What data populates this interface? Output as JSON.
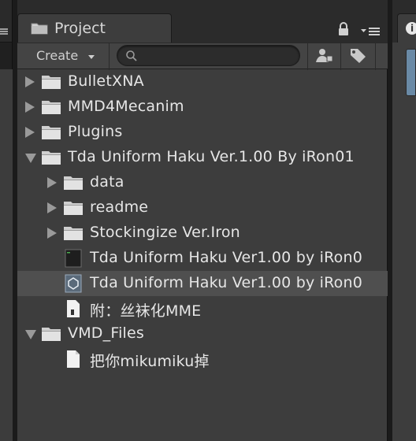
{
  "project_panel": {
    "tab_label": "Project",
    "create_label": "Create",
    "search_placeholder": "",
    "search_value": ""
  },
  "right_panel": {
    "tab_glyph": "i"
  },
  "tree": [
    {
      "label": "BulletXNA",
      "indent": 0,
      "arrow": "right",
      "icon": "folder-icon",
      "selected": false
    },
    {
      "label": "MMD4Mecanim",
      "indent": 0,
      "arrow": "right",
      "icon": "folder-icon",
      "selected": false
    },
    {
      "label": "Plugins",
      "indent": 0,
      "arrow": "right",
      "icon": "folder-icon",
      "selected": false
    },
    {
      "label": "Tda Uniform Haku Ver.1.00 By iRon01",
      "indent": 0,
      "arrow": "down",
      "icon": "folder-icon",
      "selected": false
    },
    {
      "label": "data",
      "indent": 1,
      "arrow": "right",
      "icon": "folder-icon",
      "selected": false
    },
    {
      "label": "readme",
      "indent": 1,
      "arrow": "right",
      "icon": "folder-icon",
      "selected": false
    },
    {
      "label": "Stockingize Ver.Iron",
      "indent": 1,
      "arrow": "right",
      "icon": "folder-icon",
      "selected": false
    },
    {
      "label": "Tda Uniform Haku Ver1.00 by iRon0",
      "indent": 1,
      "arrow": "none",
      "icon": "terminal-file-icon",
      "selected": false
    },
    {
      "label": "Tda Uniform Haku Ver1.00 by iRon0",
      "indent": 1,
      "arrow": "none",
      "icon": "unity-asset-icon",
      "selected": true
    },
    {
      "label": "附：丝袜化MME",
      "indent": 1,
      "arrow": "none",
      "icon": "text-file-icon",
      "selected": false
    },
    {
      "label": "VMD_Files",
      "indent": 0,
      "arrow": "down",
      "icon": "folder-icon",
      "selected": false
    },
    {
      "label": "把你mikumiku掉",
      "indent": 1,
      "arrow": "none",
      "icon": "document-icon",
      "selected": false
    }
  ],
  "colors": {
    "panel_bg": "#3d3d3d",
    "selection_bg": "#4f4f4f",
    "text": "#e6e6e6"
  }
}
